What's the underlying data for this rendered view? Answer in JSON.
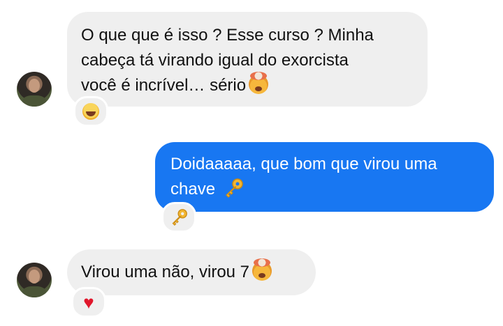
{
  "messages": [
    {
      "sender": "contact",
      "lines": [
        "O que que é isso ? Esse curso ? Minha",
        "cabeça tá virando igual do exorcista",
        "você é incrível… sério"
      ],
      "trailing_emoji": "exploding-head",
      "reaction": "face-with-tears-of-joy"
    },
    {
      "sender": "me",
      "lines": [
        "Doidaaaaa, que bom que virou uma",
        "chave"
      ],
      "trailing_emoji": "key",
      "reaction": "key"
    },
    {
      "sender": "contact",
      "lines": [
        "Virou uma não, virou 7"
      ],
      "trailing_emoji": "exploding-head",
      "reaction": "red-heart"
    }
  ],
  "colors": {
    "incoming_bubble": "#efefef",
    "outgoing_bubble": "#1877f2",
    "heart": "#e0162b"
  },
  "heart_glyph": "♥"
}
